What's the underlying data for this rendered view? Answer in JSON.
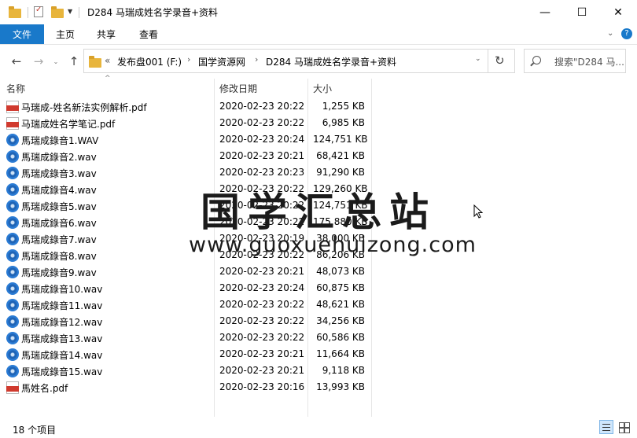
{
  "window": {
    "title": "D284 马瑞成姓名学录音+资料",
    "minimize_glyph": "—",
    "maximize_glyph": "☐",
    "close_glyph": "✕"
  },
  "ribbon": {
    "file": "文件",
    "home": "主页",
    "share": "共享",
    "view": "查看"
  },
  "address": {
    "overflow": "«",
    "crumbs": [
      "发布盘001 (F:)",
      "国学资源网",
      "D284 马瑞成姓名学录音+资料"
    ],
    "search_placeholder": "搜索\"D284 马..."
  },
  "columns": {
    "name": "名称",
    "date": "修改日期",
    "size": "大小"
  },
  "files": [
    {
      "name": "马瑞成-姓名新法实例解析.pdf",
      "date": "2020-02-23 20:22",
      "size": "1,255 KB",
      "type": "pdf"
    },
    {
      "name": "马瑞成姓名学笔记.pdf",
      "date": "2020-02-23 20:22",
      "size": "6,985 KB",
      "type": "pdf"
    },
    {
      "name": "馬瑞成錄音1.WAV",
      "date": "2020-02-23 20:24",
      "size": "124,751 KB",
      "type": "wav"
    },
    {
      "name": "馬瑞成錄音2.wav",
      "date": "2020-02-23 20:21",
      "size": "68,421 KB",
      "type": "wav"
    },
    {
      "name": "馬瑞成錄音3.wav",
      "date": "2020-02-23 20:23",
      "size": "91,290 KB",
      "type": "wav"
    },
    {
      "name": "馬瑞成錄音4.wav",
      "date": "2020-02-23 20:22",
      "size": "129,260 KB",
      "type": "wav"
    },
    {
      "name": "馬瑞成錄音5.wav",
      "date": "2020-02-23 20:22",
      "size": "124,751 KB",
      "type": "wav"
    },
    {
      "name": "馬瑞成錄音6.wav",
      "date": "2020-02-23 20:22",
      "size": "175,880 KB",
      "type": "wav"
    },
    {
      "name": "馬瑞成錄音7.wav",
      "date": "2020-02-23 20:19",
      "size": "38,000 KB",
      "type": "wav"
    },
    {
      "name": "馬瑞成錄音8.wav",
      "date": "2020-02-23 20:22",
      "size": "86,206 KB",
      "type": "wav"
    },
    {
      "name": "馬瑞成錄音9.wav",
      "date": "2020-02-23 20:21",
      "size": "48,073 KB",
      "type": "wav"
    },
    {
      "name": "馬瑞成錄音10.wav",
      "date": "2020-02-23 20:24",
      "size": "60,875 KB",
      "type": "wav"
    },
    {
      "name": "馬瑞成錄音11.wav",
      "date": "2020-02-23 20:22",
      "size": "48,621 KB",
      "type": "wav"
    },
    {
      "name": "馬瑞成錄音12.wav",
      "date": "2020-02-23 20:22",
      "size": "34,256 KB",
      "type": "wav"
    },
    {
      "name": "馬瑞成錄音13.wav",
      "date": "2020-02-23 20:22",
      "size": "60,586 KB",
      "type": "wav"
    },
    {
      "name": "馬瑞成錄音14.wav",
      "date": "2020-02-23 20:21",
      "size": "11,664 KB",
      "type": "wav"
    },
    {
      "name": "馬瑞成錄音15.wav",
      "date": "2020-02-23 20:21",
      "size": "9,118 KB",
      "type": "wav"
    },
    {
      "name": "馬姓名.pdf",
      "date": "2020-02-23 20:16",
      "size": "13,993 KB",
      "type": "pdf"
    }
  ],
  "watermark": {
    "title": "国学汇总站",
    "url": "www.guoxuehuizong.com"
  },
  "status": {
    "count": "18 个项目"
  },
  "colors": {
    "accent": "#1979ca",
    "pdf_red": "#d03a2e",
    "wav_blue": "#1f64b6"
  }
}
